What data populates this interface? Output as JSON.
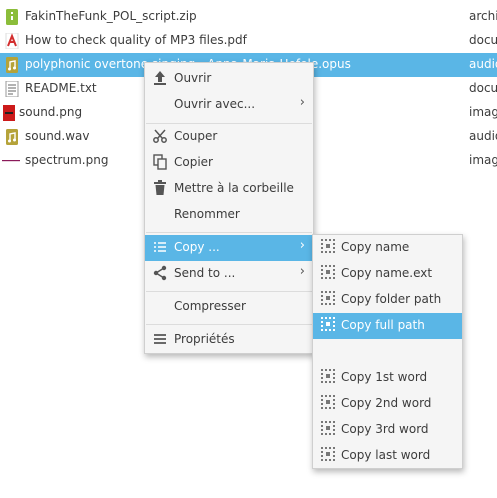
{
  "files": [
    {
      "name": "FakinTheFunk_POL_script.zip",
      "type": "archi",
      "icon": "archive-icon"
    },
    {
      "name": "How to check quality of MP3 files.pdf",
      "type": "docu",
      "icon": "pdf-icon"
    },
    {
      "name": "polyphonic overtone singing - Anna-Maria Hefele.opus",
      "type": "audio",
      "icon": "audio-icon"
    },
    {
      "name": "README.txt",
      "type": "docu",
      "icon": "text-file-icon"
    },
    {
      "name": "sound.png",
      "type": "imag",
      "icon": "image-icon"
    },
    {
      "name": "sound.wav",
      "type": "audio",
      "icon": "audio-icon"
    },
    {
      "name": "spectrum.png",
      "type": "imag",
      "icon": "image-icon"
    }
  ],
  "context_menu": {
    "open": "Ouvrir",
    "open_with": "Ouvrir avec...",
    "cut": "Couper",
    "copy": "Copier",
    "trash": "Mettre à la corbeille",
    "rename": "Renommer",
    "copy_sub": "Copy ...",
    "send_to": "Send to ...",
    "compress": "Compresser",
    "properties": "Propriétés"
  },
  "submenu": {
    "copy_name": "Copy name",
    "copy_name_ext": "Copy name.ext",
    "copy_folder_path": "Copy folder path",
    "copy_full_path": "Copy full path",
    "copy_1st_word": "Copy 1st word",
    "copy_2nd_word": "Copy 2nd word",
    "copy_3rd_word": "Copy 3rd word",
    "copy_last_word": "Copy last word"
  },
  "colors": {
    "selection": "#5ab6e6",
    "menu_bg": "#f5f5f5"
  }
}
